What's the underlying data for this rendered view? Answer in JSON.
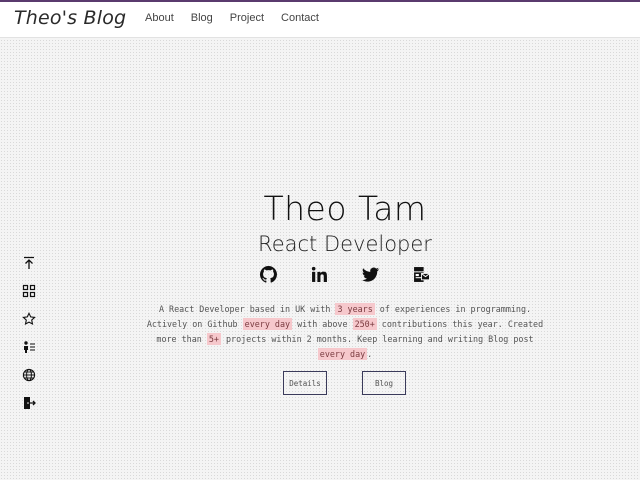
{
  "header": {
    "brand": "Theo's Blog",
    "nav": [
      "About",
      "Blog",
      "Project",
      "Contact"
    ]
  },
  "hero": {
    "name": "Theo Tam",
    "role": "React Developer",
    "socials": [
      "github-icon",
      "linkedin-icon",
      "twitter-icon",
      "contact-card-icon"
    ],
    "intro": [
      {
        "text": "A React Developer based in UK with ",
        "hl": false
      },
      {
        "text": "3 years",
        "hl": true
      },
      {
        "text": " of experiences in programming. Actively on Github ",
        "hl": false
      },
      {
        "text": "every day",
        "hl": true
      },
      {
        "text": " with above ",
        "hl": false
      },
      {
        "text": "250+",
        "hl": true
      },
      {
        "text": " contributions this year. Created more than ",
        "hl": false
      },
      {
        "text": "5+",
        "hl": true
      },
      {
        "text": " projects within 2 months. Keep learning and writing Blog post ",
        "hl": false
      },
      {
        "text": "every day",
        "hl": true
      },
      {
        "text": ".",
        "hl": false
      }
    ],
    "buttons": {
      "details": "Details",
      "blog": "Blog"
    }
  },
  "sidebar": {
    "icons": [
      "scroll-top-icon",
      "grid-icon",
      "star-icon",
      "person-list-icon",
      "globe-icon",
      "exit-icon"
    ]
  },
  "colors": {
    "accent_line": "#5a3a6e",
    "highlight": "#f6c8cc"
  }
}
